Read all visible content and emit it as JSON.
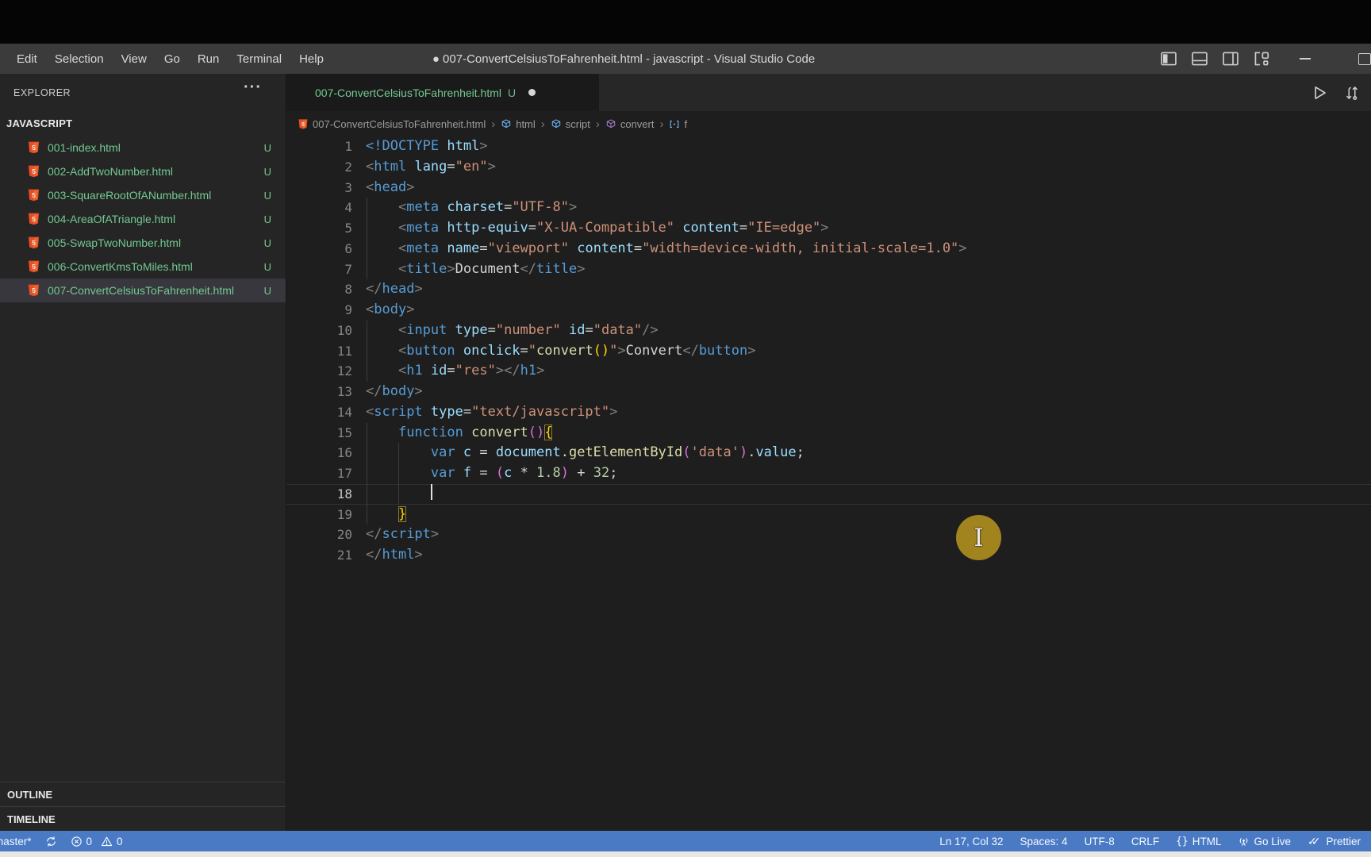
{
  "title_bar": {
    "menus": [
      "Edit",
      "Selection",
      "View",
      "Go",
      "Run",
      "Terminal",
      "Help"
    ],
    "title": "● 007-ConvertCelsiusToFahrenheit.html - javascript - Visual Studio Code"
  },
  "explorer": {
    "header": "EXPLORER",
    "actions": "···",
    "section": "JAVASCRIPT",
    "files": [
      {
        "name": "001-index.html",
        "badge": "U"
      },
      {
        "name": "002-AddTwoNumber.html",
        "badge": "U"
      },
      {
        "name": "003-SquareRootOfANumber.html",
        "badge": "U"
      },
      {
        "name": "004-AreaOfATriangle.html",
        "badge": "U"
      },
      {
        "name": "005-SwapTwoNumber.html",
        "badge": "U"
      },
      {
        "name": "006-ConvertKmsToMiles.html",
        "badge": "U"
      },
      {
        "name": "007-ConvertCelsiusToFahrenheit.html",
        "badge": "U",
        "selected": true
      }
    ],
    "outline": "OUTLINE",
    "timeline": "TIMELINE"
  },
  "editor": {
    "tab": {
      "name": "007-ConvertCelsiusToFahrenheit.html",
      "git_badge": "U",
      "modified": true
    },
    "breadcrumbs": [
      {
        "label": "007-ConvertCelsiusToFahrenheit.html",
        "icon": "html5-icon"
      },
      {
        "label": "html",
        "icon": "symbol-cube-blue"
      },
      {
        "label": "script",
        "icon": "symbol-cube-blue"
      },
      {
        "label": "convert",
        "icon": "symbol-cube-purple"
      },
      {
        "label": "f",
        "icon": "symbol-variable"
      }
    ],
    "code": {
      "lines": [
        {
          "n": 1,
          "s": [
            [
              "<!DOCTYPE ",
              "tag"
            ],
            [
              "html",
              "attr"
            ],
            [
              ">",
              "p"
            ]
          ]
        },
        {
          "n": 2,
          "s": [
            [
              "<",
              "p"
            ],
            [
              "html",
              "tag"
            ],
            [
              " ",
              "d"
            ],
            [
              "lang",
              "attr"
            ],
            [
              "=",
              "d"
            ],
            [
              "\"en\"",
              "str"
            ],
            [
              ">",
              "p"
            ]
          ]
        },
        {
          "n": 3,
          "s": [
            [
              "<",
              "p"
            ],
            [
              "head",
              "tag"
            ],
            [
              ">",
              "p"
            ]
          ]
        },
        {
          "n": 4,
          "s": [
            [
              "    ",
              "d"
            ],
            [
              "<",
              "p"
            ],
            [
              "meta",
              "tag"
            ],
            [
              " ",
              "d"
            ],
            [
              "charset",
              "attr"
            ],
            [
              "=",
              "d"
            ],
            [
              "\"UTF-8\"",
              "str"
            ],
            [
              ">",
              "p"
            ]
          ]
        },
        {
          "n": 5,
          "s": [
            [
              "    ",
              "d"
            ],
            [
              "<",
              "p"
            ],
            [
              "meta",
              "tag"
            ],
            [
              " ",
              "d"
            ],
            [
              "http-equiv",
              "attr"
            ],
            [
              "=",
              "d"
            ],
            [
              "\"X-UA-Compatible\"",
              "str"
            ],
            [
              " ",
              "d"
            ],
            [
              "content",
              "attr"
            ],
            [
              "=",
              "d"
            ],
            [
              "\"IE=edge\"",
              "str"
            ],
            [
              ">",
              "p"
            ]
          ]
        },
        {
          "n": 6,
          "s": [
            [
              "    ",
              "d"
            ],
            [
              "<",
              "p"
            ],
            [
              "meta",
              "tag"
            ],
            [
              " ",
              "d"
            ],
            [
              "name",
              "attr"
            ],
            [
              "=",
              "d"
            ],
            [
              "\"viewport\"",
              "str"
            ],
            [
              " ",
              "d"
            ],
            [
              "content",
              "attr"
            ],
            [
              "=",
              "d"
            ],
            [
              "\"width=device-width, initial-scale=1.0\"",
              "str"
            ],
            [
              ">",
              "p"
            ]
          ]
        },
        {
          "n": 7,
          "s": [
            [
              "    ",
              "d"
            ],
            [
              "<",
              "p"
            ],
            [
              "title",
              "tag"
            ],
            [
              ">",
              "p"
            ],
            [
              "Document",
              "d"
            ],
            [
              "</",
              "p"
            ],
            [
              "title",
              "tag"
            ],
            [
              ">",
              "p"
            ]
          ]
        },
        {
          "n": 8,
          "s": [
            [
              "</",
              "p"
            ],
            [
              "head",
              "tag"
            ],
            [
              ">",
              "p"
            ]
          ]
        },
        {
          "n": 9,
          "s": [
            [
              "<",
              "p"
            ],
            [
              "body",
              "tag"
            ],
            [
              ">",
              "p"
            ]
          ]
        },
        {
          "n": 10,
          "s": [
            [
              "    ",
              "d"
            ],
            [
              "<",
              "p"
            ],
            [
              "input",
              "tag"
            ],
            [
              " ",
              "d"
            ],
            [
              "type",
              "attr"
            ],
            [
              "=",
              "d"
            ],
            [
              "\"number\"",
              "str"
            ],
            [
              " ",
              "d"
            ],
            [
              "id",
              "attr"
            ],
            [
              "=",
              "d"
            ],
            [
              "\"data\"",
              "str"
            ],
            [
              "/>",
              "p"
            ]
          ]
        },
        {
          "n": 11,
          "s": [
            [
              "    ",
              "d"
            ],
            [
              "<",
              "p"
            ],
            [
              "button",
              "tag"
            ],
            [
              " ",
              "d"
            ],
            [
              "onclick",
              "attr"
            ],
            [
              "=",
              "d"
            ],
            [
              "\"",
              "str"
            ],
            [
              "convert",
              "fn"
            ],
            [
              "()",
              "b1"
            ],
            [
              "\"",
              "str"
            ],
            [
              ">",
              "p"
            ],
            [
              "Convert",
              "d"
            ],
            [
              "</",
              "p"
            ],
            [
              "button",
              "tag"
            ],
            [
              ">",
              "p"
            ]
          ]
        },
        {
          "n": 12,
          "s": [
            [
              "    ",
              "d"
            ],
            [
              "<",
              "p"
            ],
            [
              "h1",
              "tag"
            ],
            [
              " ",
              "d"
            ],
            [
              "id",
              "attr"
            ],
            [
              "=",
              "d"
            ],
            [
              "\"res\"",
              "str"
            ],
            [
              ">",
              "p"
            ],
            [
              "</",
              "p"
            ],
            [
              "h1",
              "tag"
            ],
            [
              ">",
              "p"
            ]
          ]
        },
        {
          "n": 13,
          "s": [
            [
              "</",
              "p"
            ],
            [
              "body",
              "tag"
            ],
            [
              ">",
              "p"
            ]
          ]
        },
        {
          "n": 14,
          "s": [
            [
              "<",
              "p"
            ],
            [
              "script",
              "tag"
            ],
            [
              " ",
              "d"
            ],
            [
              "type",
              "attr"
            ],
            [
              "=",
              "d"
            ],
            [
              "\"text/javascript\"",
              "str"
            ],
            [
              ">",
              "p"
            ]
          ]
        },
        {
          "n": 15,
          "s": [
            [
              "    ",
              "d"
            ],
            [
              "function",
              "kw"
            ],
            [
              " ",
              "d"
            ],
            [
              "convert",
              "fn"
            ],
            [
              "()",
              "b2"
            ],
            [
              "{",
              "b1x"
            ]
          ]
        },
        {
          "n": 16,
          "s": [
            [
              "        ",
              "d"
            ],
            [
              "var",
              "kw"
            ],
            [
              " ",
              "d"
            ],
            [
              "c",
              "var"
            ],
            [
              " = ",
              "d"
            ],
            [
              "document",
              "var"
            ],
            [
              ".",
              "d"
            ],
            [
              "getElementById",
              "fn"
            ],
            [
              "(",
              "b2"
            ],
            [
              "'data'",
              "str"
            ],
            [
              ")",
              "b2"
            ],
            [
              ".",
              "d"
            ],
            [
              "value",
              "var"
            ],
            [
              ";",
              "d"
            ]
          ]
        },
        {
          "n": 17,
          "s": [
            [
              "        ",
              "d"
            ],
            [
              "var",
              "kw"
            ],
            [
              " ",
              "d"
            ],
            [
              "f",
              "var"
            ],
            [
              " = ",
              "d"
            ],
            [
              "(",
              "b2"
            ],
            [
              "c",
              "var"
            ],
            [
              " * ",
              "d"
            ],
            [
              "1.8",
              "num"
            ],
            [
              ")",
              "b2"
            ],
            [
              " + ",
              "d"
            ],
            [
              "32",
              "num"
            ],
            [
              ";",
              "d"
            ]
          ]
        },
        {
          "n": 18,
          "s": [
            [
              "        ",
              "d"
            ]
          ],
          "cursor": true,
          "current": true
        },
        {
          "n": 19,
          "s": [
            [
              "    ",
              "d"
            ],
            [
              "}",
              "b1x"
            ]
          ]
        },
        {
          "n": 20,
          "s": [
            [
              "</",
              "p"
            ],
            [
              "script",
              "tag"
            ],
            [
              ">",
              "p"
            ]
          ]
        },
        {
          "n": 21,
          "s": [
            [
              "</",
              "p"
            ],
            [
              "html",
              "tag"
            ],
            [
              ">",
              "p"
            ]
          ]
        }
      ]
    }
  },
  "status_bar": {
    "branch": "master*",
    "errors": "0",
    "warnings": "0",
    "line_col": "Ln 17, Col 32",
    "indentation": "Spaces: 4",
    "encoding": "UTF-8",
    "eol": "CRLF",
    "language": "HTML",
    "go_live": "Go Live",
    "formatter": "Prettier",
    "formatter_icon": "✓✓",
    "language_icon": "{}"
  },
  "colors": {
    "status_bar_bg": "#4a7ac4",
    "git_untracked_green": "#73c991",
    "html_icon_orange": "#e44d26",
    "mouse_highlight": "#ad8c1f",
    "bracket_gold": "#ffd700",
    "bracket_purple": "#da70d6",
    "selection_row": "#37373d"
  },
  "icons": [
    "html5-icon",
    "symbol-cube-blue",
    "symbol-cube-purple",
    "symbol-variable",
    "run-icon",
    "open-changes-icon",
    "toggle-sidebar-icon",
    "toggle-panel-icon",
    "toggle-secondary-sidebar-icon",
    "customize-layout-icon",
    "minimize-icon",
    "restore-icon",
    "sync-icon",
    "error-icon",
    "warning-icon",
    "broadcast-icon",
    "more-actions-icon"
  ]
}
